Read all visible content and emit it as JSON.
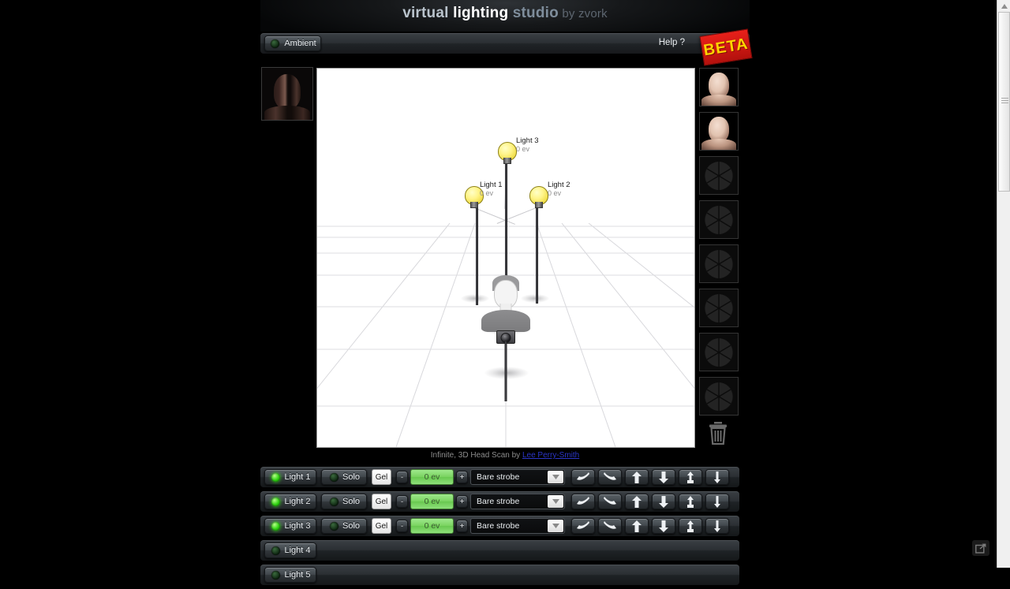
{
  "header": {
    "title_part1": "virtual ",
    "title_part2": "lighting ",
    "title_part3": "studio",
    "title_by": " by zvork",
    "beta_badge": "BETA"
  },
  "toolbar": {
    "ambient_label": "Ambient",
    "ambient_led": "off",
    "help_label": "Help ?"
  },
  "viewport": {
    "caption_text": "Infinite, 3D Head Scan by ",
    "caption_link": "Lee Perry-Smith",
    "lights": [
      {
        "name": "Light 3",
        "ev": "0 ev"
      },
      {
        "name": "Light 1",
        "ev": "0 ev"
      },
      {
        "name": "Light 2",
        "ev": "0 ev"
      }
    ]
  },
  "sidebar": {
    "thumbnails": [
      {
        "type": "render",
        "name": "render-thumbnail-1"
      },
      {
        "type": "render",
        "name": "render-thumbnail-2"
      },
      {
        "type": "empty",
        "name": "empty-slot-1"
      },
      {
        "type": "empty",
        "name": "empty-slot-2"
      },
      {
        "type": "empty",
        "name": "empty-slot-3"
      },
      {
        "type": "empty",
        "name": "empty-slot-4"
      },
      {
        "type": "empty",
        "name": "empty-slot-5"
      },
      {
        "type": "empty",
        "name": "empty-slot-6"
      }
    ],
    "trash_icon": "trash-icon"
  },
  "light_rows": [
    {
      "name": "Light 1",
      "enabled": true,
      "solo_label": "Solo",
      "solo_on": false,
      "gel_label": "Gel",
      "minus_label": "-",
      "plus_label": "+",
      "ev_value": "0 ev",
      "modifier": "Bare strobe",
      "actions": [
        "rotate-left-icon",
        "rotate-right-icon",
        "arrow-up-icon",
        "arrow-down-icon",
        "raise-icon",
        "lower-icon"
      ]
    },
    {
      "name": "Light 2",
      "enabled": true,
      "solo_label": "Solo",
      "solo_on": false,
      "gel_label": "Gel",
      "minus_label": "-",
      "plus_label": "+",
      "ev_value": "0 ev",
      "modifier": "Bare strobe",
      "actions": [
        "rotate-left-icon",
        "rotate-right-icon",
        "arrow-up-icon",
        "arrow-down-icon",
        "raise-icon",
        "lower-icon"
      ]
    },
    {
      "name": "Light 3",
      "enabled": true,
      "solo_label": "Solo",
      "solo_on": false,
      "gel_label": "Gel",
      "minus_label": "-",
      "plus_label": "+",
      "ev_value": "0 ev",
      "modifier": "Bare strobe",
      "actions": [
        "rotate-left-icon",
        "rotate-right-icon",
        "arrow-up-icon",
        "arrow-down-icon",
        "raise-icon",
        "lower-icon"
      ]
    },
    {
      "name": "Light 4",
      "enabled": false
    },
    {
      "name": "Light 5",
      "enabled": false
    }
  ],
  "footer": {
    "popout_icon": "external-link-icon"
  },
  "colors": {
    "accent_green": "#79d35f",
    "led_on": "#2fd411",
    "beta_red": "#e8201a",
    "beta_yellow": "#ffd400",
    "link_blue": "#2b36c8"
  }
}
